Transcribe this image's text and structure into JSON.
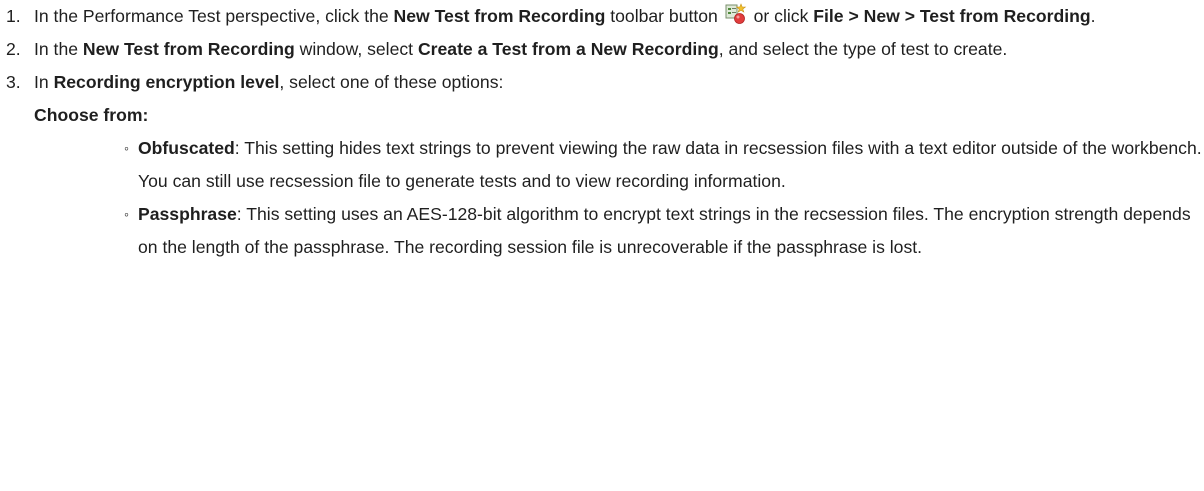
{
  "steps": [
    {
      "num": "1.",
      "t1": "In the Performance Test perspective, click the ",
      "b1": "New Test from Recording",
      "t2": " toolbar button ",
      "icon": "new-test-from-recording-icon",
      "t3": " or click ",
      "b2": "File > New > Test from Recording",
      "t4": "."
    },
    {
      "num": "2.",
      "t1": "In the ",
      "b1": "New Test from Recording",
      "t2": " window, select ",
      "b2": "Create a Test from a New Recording",
      "t3": ", and select the type of test to create."
    },
    {
      "num": "3.",
      "t1": "In ",
      "b1": "Recording encryption level",
      "t2": ", select one of these options:",
      "choose": "Choose from:",
      "options": [
        {
          "bullet": "◦",
          "name": "Obfuscated",
          "text": ": This setting hides text strings to prevent viewing the raw data in recsession files with a text editor outside of the workbench. You can still use recsession file to generate tests and to view recording information."
        },
        {
          "bullet": "◦",
          "name": "Passphrase",
          "text": ": This setting uses an AES-128-bit algorithm to encrypt text strings in the recsession files. The encryption strength depends on the length of the passphrase. The recording session file is unrecoverable if the passphrase is lost."
        }
      ]
    }
  ]
}
